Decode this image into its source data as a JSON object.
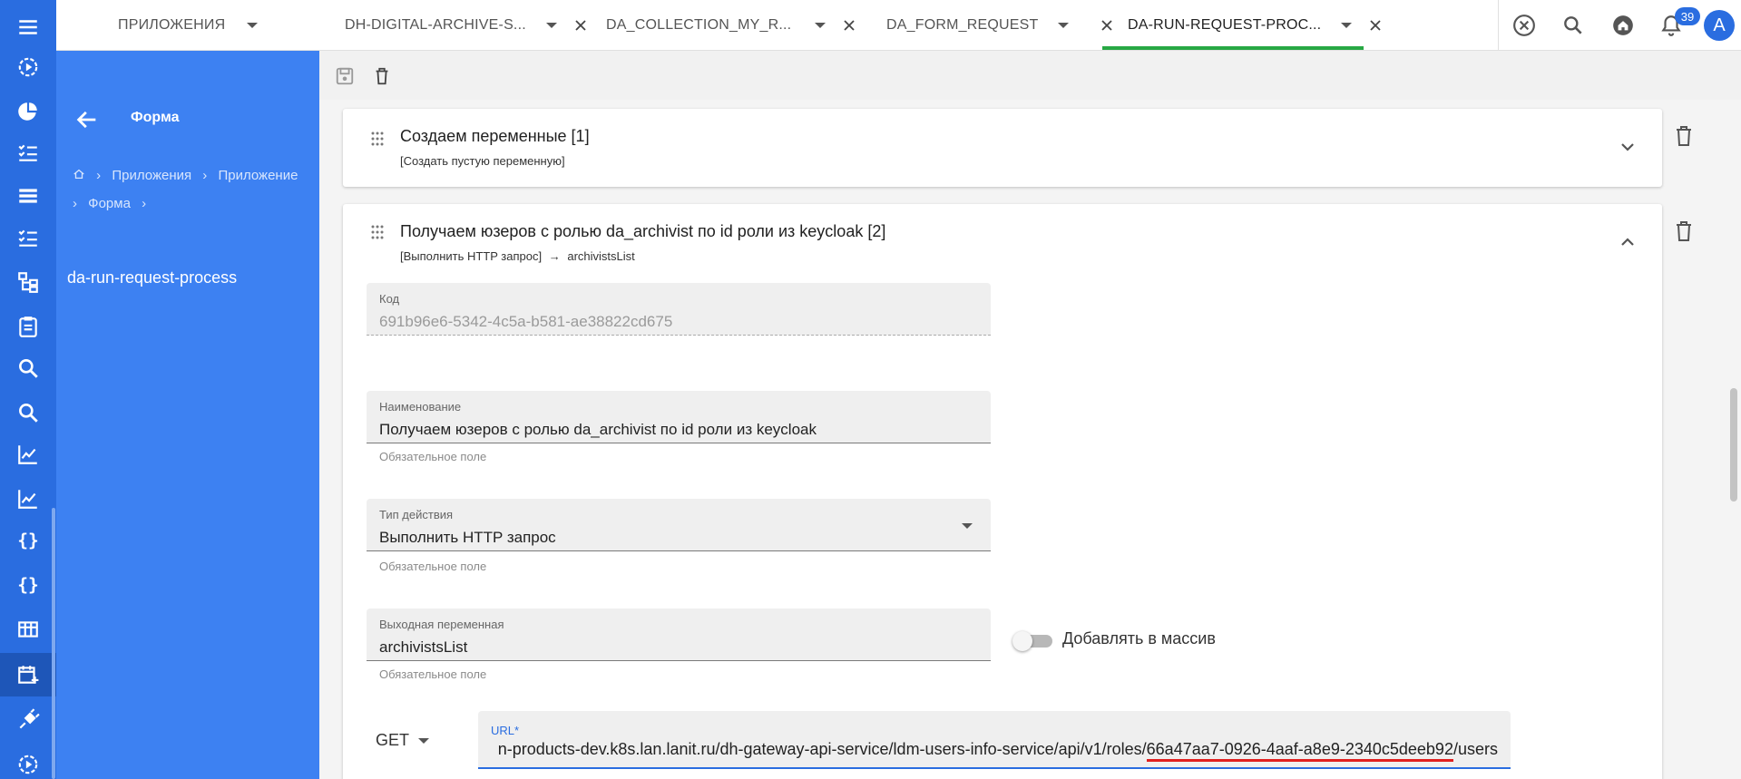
{
  "tabs": [
    {
      "label": "ПРИЛОЖЕНИЯ",
      "closable": false
    },
    {
      "label": "DH-DIGITAL-ARCHIVE-S...",
      "closable": true
    },
    {
      "label": "DA_COLLECTION_MY_R...",
      "closable": true
    },
    {
      "label": "DA_FORM_REQUEST",
      "closable": true
    },
    {
      "label": "DA-RUN-REQUEST-PROC...",
      "closable": true,
      "active": true
    }
  ],
  "header": {
    "notifications_count": "39",
    "avatar_initial": "A"
  },
  "sidepanel": {
    "title": "Форма",
    "breadcrumbs": [
      "Приложения",
      "Приложение",
      "Форма"
    ],
    "name": "da-run-request-process"
  },
  "steps": [
    {
      "title": "Создаем переменные [1]",
      "subtitle": "[Создать пустую переменную]"
    },
    {
      "title": "Получаем юзеров с ролью da_archivist по id роли из keycloak [2]",
      "subtitle_action": "[Выполнить HTTP запрос]",
      "subtitle_arrow": "→",
      "subtitle_target": "archivistsList"
    }
  ],
  "form": {
    "code": {
      "label": "Код",
      "value": "691b96e6-5342-4c5a-b581-ae38822cd675"
    },
    "name": {
      "label": "Наименование",
      "value": "Получаем юзеров с ролью da_archivist по id роли из keycloak",
      "hint": "Обязательное поле"
    },
    "action_type": {
      "label": "Тип действия",
      "value": "Выполнить HTTP запрос",
      "hint": "Обязательное поле"
    },
    "output_var": {
      "label": "Выходная переменная",
      "value": "archivistsList",
      "hint": "Обязательное поле"
    },
    "add_to_array": {
      "label": "Добавлять в массив",
      "checked": false
    },
    "method": "GET",
    "url": {
      "label": "URL*",
      "prefix": "n-products-dev.k8s.lan.lanit.ru/dh-gateway-api-service/ldm-users-info-service/api/v1/roles/",
      "highlight": "66a47aa7-0926-4aaf-a8e9-2340c5deeb92",
      "suffix": "/users"
    }
  },
  "colors": {
    "rail": "#2a6de0",
    "sidepanel": "#3d81f2",
    "active_tab": "#27a844",
    "highlight_underline": "#e02020"
  }
}
